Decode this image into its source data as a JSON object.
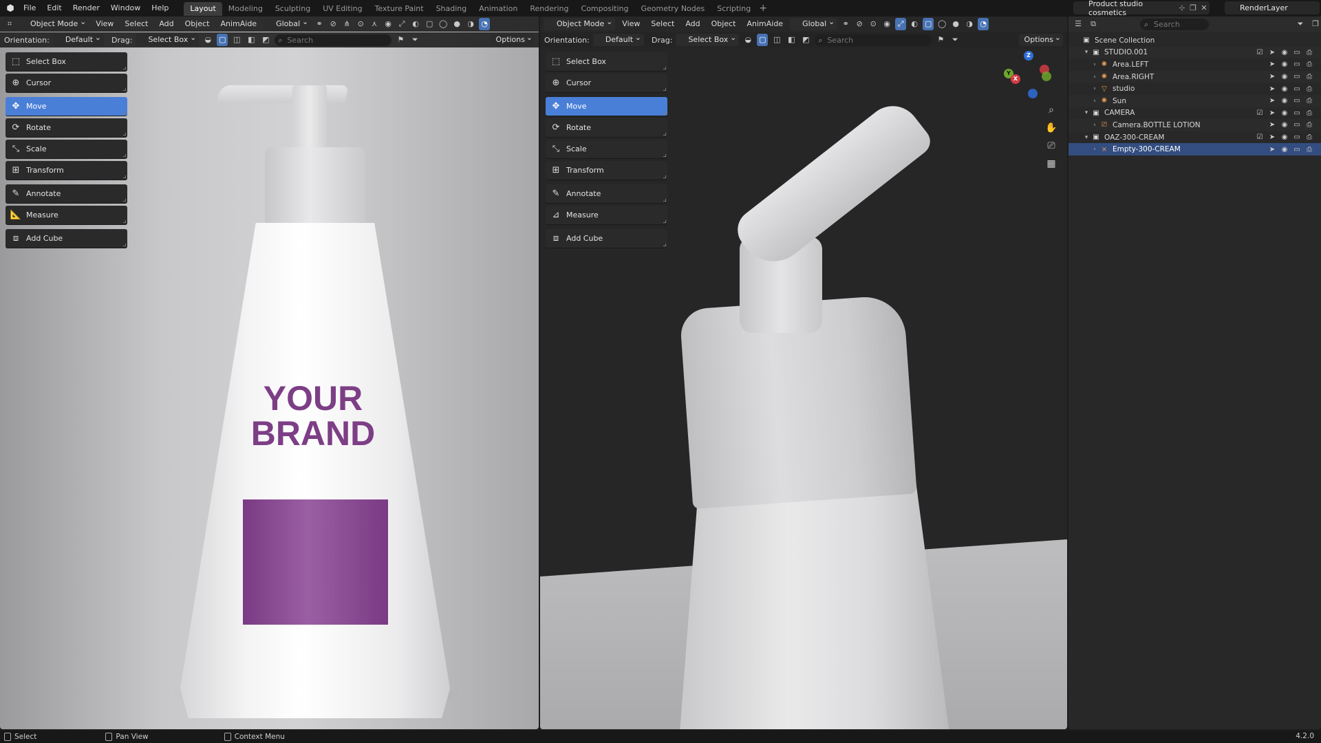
{
  "menu": {
    "items": [
      "File",
      "Edit",
      "Render",
      "Window",
      "Help"
    ]
  },
  "workspaces": {
    "tabs": [
      "Layout",
      "Modeling",
      "Sculpting",
      "UV Editing",
      "Texture Paint",
      "Shading",
      "Animation",
      "Rendering",
      "Compositing",
      "Geometry Nodes",
      "Scripting"
    ],
    "active": "Layout"
  },
  "scene": {
    "name": "Product studio cosmetics"
  },
  "view_layer": {
    "name": "RenderLayer"
  },
  "viewport_left": {
    "mode": "Object Mode",
    "menus": [
      "View",
      "Select",
      "Add",
      "Object",
      "AnimAide"
    ],
    "transform_orientation": "Global",
    "orientation_label": "Orientation:",
    "orientation_value": "Default",
    "drag_label": "Drag:",
    "drag_value": "Select Box",
    "search_placeholder": "Search",
    "options_label": "Options",
    "brand_line1": "YOUR",
    "brand_line2": "BRAND"
  },
  "viewport_right": {
    "mode": "Object Mode",
    "menus": [
      "View",
      "Select",
      "Add",
      "Object",
      "AnimAide"
    ],
    "transform_orientation": "Global",
    "orientation_label": "Orientation:",
    "orientation_value": "Default",
    "drag_label": "Drag:",
    "drag_value": "Select Box",
    "search_placeholder": "Search",
    "options_label": "Options",
    "gizmo_z": "Z",
    "gizmo_y": "Y",
    "gizmo_x": "X"
  },
  "tools": [
    {
      "label": "Select Box",
      "icon": "select-box-icon"
    },
    {
      "label": "Cursor",
      "icon": "cursor-icon"
    },
    {
      "label": "Move",
      "icon": "move-icon",
      "active": true
    },
    {
      "label": "Rotate",
      "icon": "rotate-icon"
    },
    {
      "label": "Scale",
      "icon": "scale-icon"
    },
    {
      "label": "Transform",
      "icon": "transform-icon"
    },
    {
      "label": "Annotate",
      "icon": "annotate-icon"
    },
    {
      "label": "Measure",
      "icon": "measure-icon"
    },
    {
      "label": "Add Cube",
      "icon": "add-cube-icon"
    }
  ],
  "outliner": {
    "search_placeholder": "Search",
    "rows": [
      {
        "label": "Scene Collection"
      },
      {
        "label": "STUDIO.001"
      },
      {
        "label": "Area.LEFT"
      },
      {
        "label": "Area.RIGHT"
      },
      {
        "label": "studio"
      },
      {
        "label": "Sun"
      },
      {
        "label": "CAMERA"
      },
      {
        "label": "Camera.BOTTLE LOTION"
      },
      {
        "label": "OAZ-300-CREAM"
      },
      {
        "label": "Empty-300-CREAM"
      }
    ]
  },
  "statusbar": {
    "select": "Select",
    "pan": "Pan View",
    "context": "Context Menu",
    "version": "4.2.0"
  },
  "colors": {
    "accent": "#4a7fd8",
    "selection": "#334d80",
    "brand_purple": "#7d3e86"
  }
}
